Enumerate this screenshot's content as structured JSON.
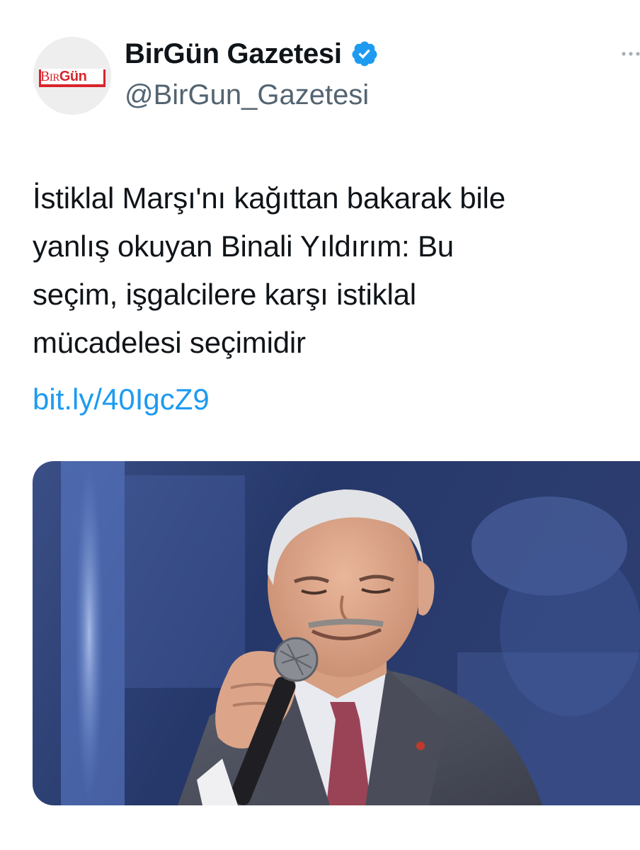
{
  "tweet": {
    "author": {
      "display_name": "BirGün Gazetesi",
      "handle": "@BirGun_Gazetesi",
      "verified": true,
      "avatar_logo_text": "BirGün",
      "avatar_icon": "birgun-logo-icon"
    },
    "text_lines": [
      "İstiklal Marşı'nı kağıttan bakarak bile",
      "yanlış okuyan Binali Yıldırım: Bu",
      "seçim, işgalciler​e karşı istiklal",
      "mücadelesi seçimidir"
    ],
    "link": "bit.ly/40IgcZ9",
    "media": {
      "icon": "photo-icon"
    }
  },
  "colors": {
    "link": "#1d9bf0",
    "verified": "#1d9bf0",
    "secondary_text": "#536471",
    "logo_red": "#d8252b"
  },
  "icons": {
    "verified": "verified-badge-icon",
    "more": "more-options-icon"
  }
}
